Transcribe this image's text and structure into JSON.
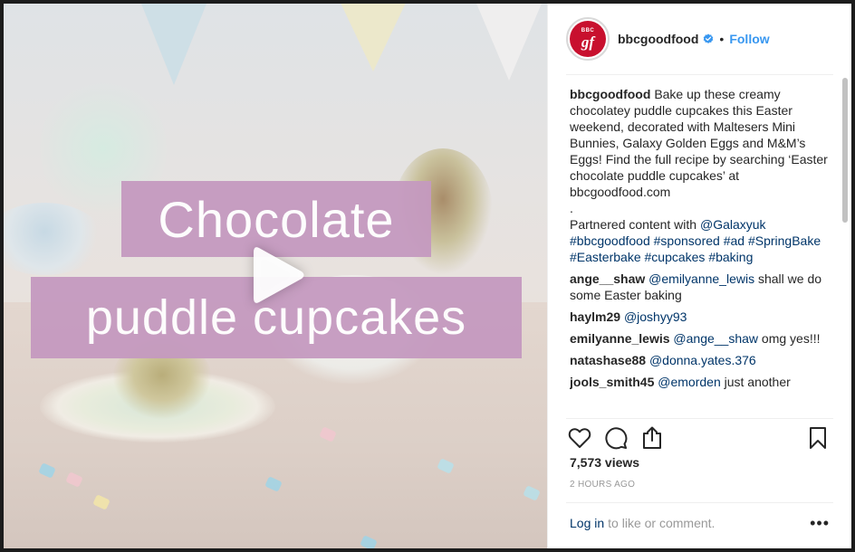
{
  "media": {
    "caption_line1": "Chocolate",
    "caption_line2": "puddle cupcakes",
    "play_icon": "play-icon",
    "band_color": "#c59ac0"
  },
  "header": {
    "avatar_text_top": "BBC",
    "avatar_text_main": "gf",
    "username": "bbcgoodfood",
    "verified_icon": "verified-badge-icon",
    "separator": "•",
    "follow_label": "Follow",
    "follow_color": "#3897f0"
  },
  "post": {
    "author": "bbcgoodfood",
    "caption": "Bake up these creamy chocolatey puddle cupcakes this Easter weekend, decorated with Maltesers Mini Bunnies, Galaxy Golden Eggs and M&M’s Eggs! Find the full recipe by searching ‘Easter chocolate puddle cupcakes’ at bbcgoodfood.com",
    "dot_line": ".",
    "partner_text": "Partnered content with ",
    "partner_handle": "@Galaxyuk",
    "hashtags": "#bbcgoodfood #sponsored #ad #SpringBake #Easterbake #cupcakes #baking"
  },
  "comments": [
    {
      "user": "ange__shaw",
      "mention": "@emilyanne_lewis",
      "text": " shall we do some Easter baking"
    },
    {
      "user": "haylm29",
      "mention": "@joshyy93",
      "text": ""
    },
    {
      "user": "emilyanne_lewis",
      "mention": "@ange__shaw",
      "text": " omg yes!!!"
    },
    {
      "user": "natashase88",
      "mention": "@donna.yates.376",
      "text": ""
    },
    {
      "user": "jools_smith45",
      "mention": "@emorden",
      "text": " just another"
    }
  ],
  "actions": {
    "like_icon": "heart-icon",
    "comment_icon": "comment-icon",
    "share_icon": "share-icon",
    "save_icon": "bookmark-icon"
  },
  "stats": {
    "views": "7,573 views",
    "time": "2 HOURS AGO"
  },
  "footer": {
    "login_label": "Log in",
    "login_rest": "to like or comment.",
    "more_icon": "more-options-icon",
    "more_label": "•••"
  }
}
